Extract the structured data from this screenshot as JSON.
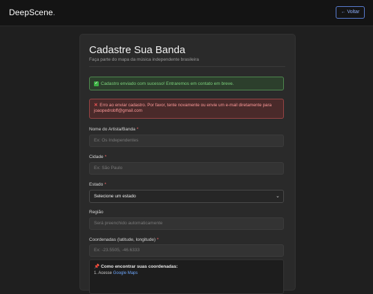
{
  "header": {
    "logo": "DeepScene",
    "logo_suffix": ".",
    "back_button": "← Voltar"
  },
  "form": {
    "title": "Cadastre Sua Banda",
    "subtitle": "Faça parte do mapa da música independente brasileira",
    "success_icon": "check-icon",
    "success_message": "Cadastro enviado com sucesso! Entraremos em contato em breve.",
    "error_icon": "x-icon",
    "error_message": "Erro ao enviar cadastro. Por favor, tente novamente ou envie um e-mail diretamente para joaopedrobff@gmail.com",
    "fields": {
      "name": {
        "label": "Nome do Artista/Banda",
        "required": "*",
        "placeholder": "Ex: Os Independentes"
      },
      "city": {
        "label": "Cidade",
        "required": "*",
        "placeholder": "Ex: São Paulo"
      },
      "state": {
        "label": "Estado",
        "required": "*",
        "value": "Selecione um estado"
      },
      "region": {
        "label": "Região",
        "placeholder": "Será preenchido automaticamente"
      },
      "coords": {
        "label": "Coordenadas (latitude, longitude)",
        "required": "*",
        "placeholder": "Ex: -23.5505, -46.6333"
      }
    },
    "help": {
      "title": "Como encontrar suas coordenadas:",
      "step1_prefix": "1. Acesse ",
      "step1_link": "Google Maps"
    }
  },
  "colors": {
    "background": "#1f1f1f",
    "accent": "#5b7fd6",
    "success": "#7dd37d",
    "error": "#ff9a9a"
  }
}
